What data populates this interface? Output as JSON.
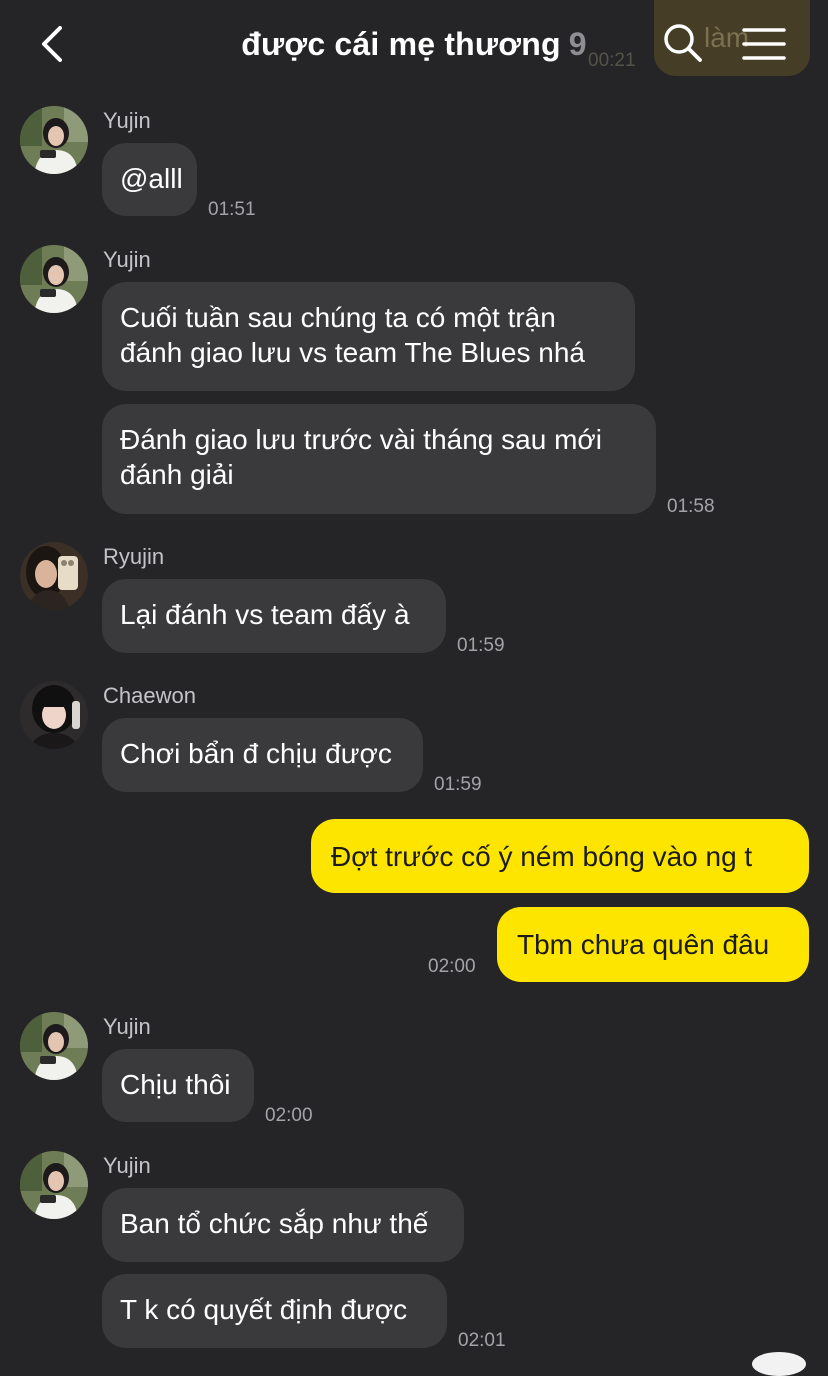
{
  "header": {
    "title": "được cái mẹ thương",
    "member_count": "9",
    "peek_text": "làm",
    "peek_time": "00:21"
  },
  "messages": [
    {
      "sender": "Yujin",
      "text": "@alll",
      "time": "01:51"
    },
    {
      "sender": "Yujin",
      "text": "Cuối tuần sau chúng ta có một trận đánh giao lưu vs team The Blues nhá"
    },
    {
      "text": "Đánh giao lưu trước vài tháng sau mới đánh giải",
      "time": "01:58"
    },
    {
      "sender": "Ryujin",
      "text": "Lại đánh vs team đấy à",
      "time": "01:59"
    },
    {
      "sender": "Chaewon",
      "text": "Chơi bẩn đ chịu được",
      "time": "01:59"
    },
    {
      "text": "Đợt trước cố ý ném bóng vào ng t"
    },
    {
      "text": "Tbm chưa quên đâu",
      "time": "02:00"
    },
    {
      "sender": "Yujin",
      "text": "Chịu thôi",
      "time": "02:00"
    },
    {
      "sender": "Yujin",
      "text": "Ban tổ chức sắp như thế"
    },
    {
      "text": "T k có quyết định được",
      "time": "02:01"
    }
  ],
  "colors": {
    "background": "#252527",
    "incoming_bubble": "#3a3a3d",
    "outgoing_bubble": "#fde500"
  }
}
